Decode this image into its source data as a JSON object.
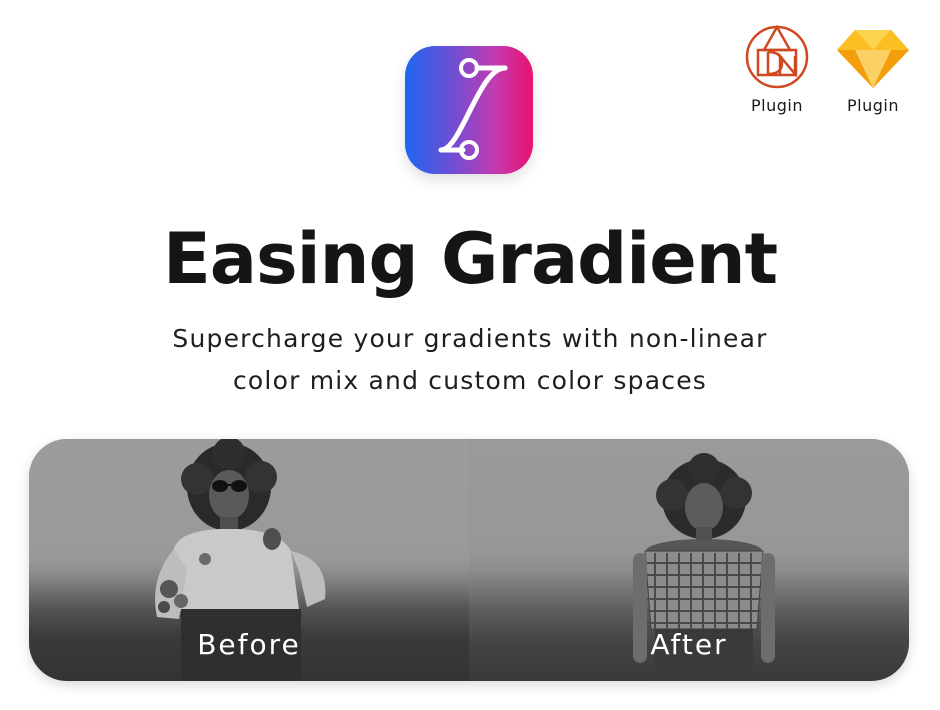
{
  "app": {
    "icon_name": "easing-curve-icon",
    "icon_gradient": [
      "#1f66f0",
      "#e8126f"
    ]
  },
  "plugins": [
    {
      "icon_name": "figma-logo-icon",
      "label": "Plugin",
      "color": "#d0481e"
    },
    {
      "icon_name": "sketch-logo-icon",
      "label": "Plugin",
      "color": "#f7a21b"
    }
  ],
  "hero": {
    "title": "Easing Gradient",
    "subtitle_line1": "Supercharge your gradients with non-linear",
    "subtitle_line2": "color mix and custom color spaces"
  },
  "comparison": {
    "before_label": "Before",
    "after_label": "After"
  }
}
